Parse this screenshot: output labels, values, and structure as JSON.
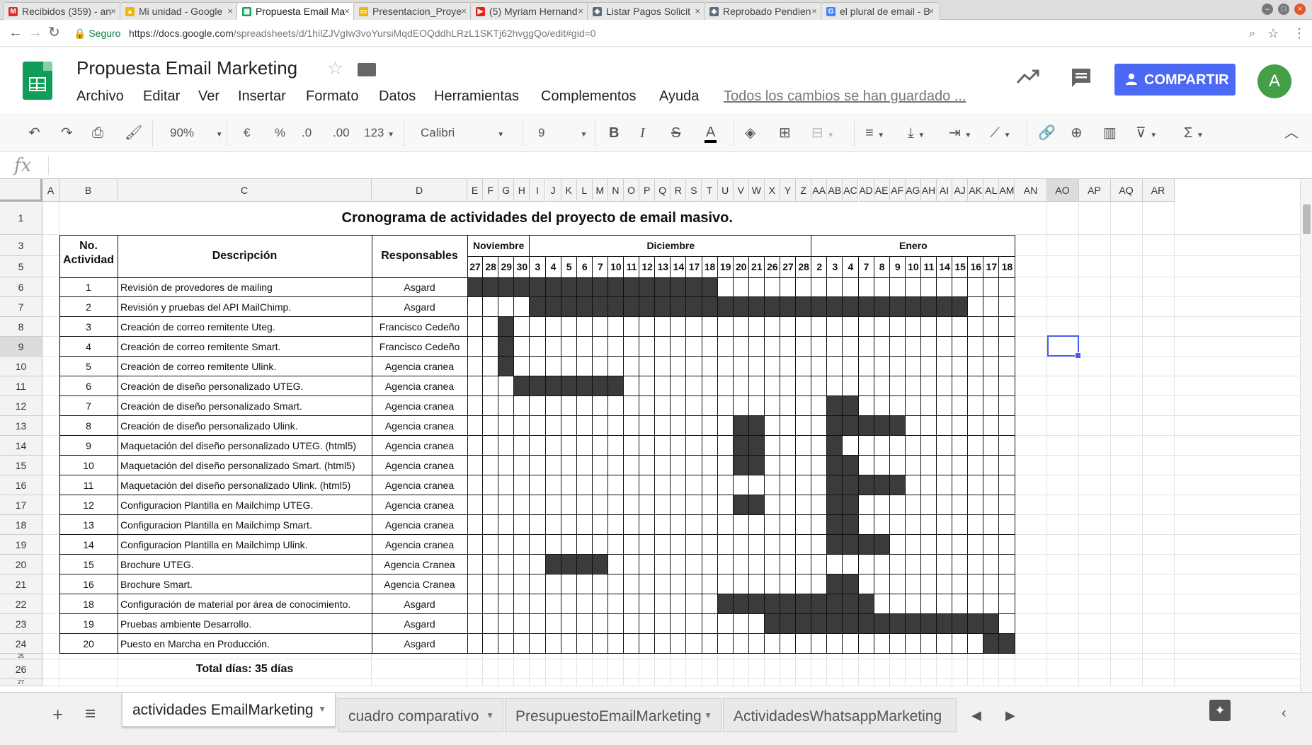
{
  "browser": {
    "tabs": [
      {
        "label": "Recibidos (359) - an",
        "icon": "gmail-icon",
        "color": "#d93025",
        "glyph": "M"
      },
      {
        "label": "Mi unidad - Google",
        "icon": "drive-icon",
        "color": "#f4b400",
        "glyph": "▲"
      },
      {
        "label": "Propuesta Email Ma",
        "icon": "sheets-icon",
        "color": "#0f9d58",
        "glyph": "▦"
      },
      {
        "label": "Presentacion_Proye",
        "icon": "slides-icon",
        "color": "#f4b400",
        "glyph": "▭"
      },
      {
        "label": "(5) Myriam Hernand",
        "icon": "youtube-icon",
        "color": "#e62117",
        "glyph": "▶"
      },
      {
        "label": "Listar Pagos Solicit",
        "icon": "shield-icon",
        "color": "#5f6b7a",
        "glyph": "◈"
      },
      {
        "label": "Reprobado Pendien",
        "icon": "shield-icon",
        "color": "#5f6b7a",
        "glyph": "◈"
      },
      {
        "label": "el plural de email - B",
        "icon": "google-icon",
        "color": "#4285f4",
        "glyph": "G"
      }
    ],
    "active_tab": 2,
    "secure_label": "Seguro",
    "url_host": "https://docs.google.com",
    "url_path": "/spreadsheets/d/1hilZJVgIw3voYursiMqdEOQddhLRzL1SKTj62hvggQo/edit#gid=0"
  },
  "app": {
    "title": "Propuesta Email Marketing",
    "menu": [
      "Archivo",
      "Editar",
      "Ver",
      "Insertar",
      "Formato",
      "Datos",
      "Herramientas",
      "Complementos",
      "Ayuda"
    ],
    "saved_status": "Todos los cambios se han guardado ...",
    "share_label": "COMPARTIR",
    "avatar_letter": "A"
  },
  "toolbar": {
    "zoom": "90%",
    "currency": "€",
    "percent": "%",
    "dec_decrease": ".0",
    "dec_increase": ".00",
    "more_formats": "123",
    "font": "Calibri",
    "font_size": "9",
    "bold": "B",
    "italic": "I",
    "strike": "S",
    "text_color": "A",
    "sum": "Σ"
  },
  "formula_bar": {
    "fx": "fx",
    "value": ""
  },
  "columns": [
    "A",
    "B",
    "C",
    "D",
    "E",
    "F",
    "G",
    "H",
    "I",
    "J",
    "K",
    "L",
    "M",
    "N",
    "O",
    "P",
    "Q",
    "R",
    "S",
    "T",
    "U",
    "V",
    "W",
    "X",
    "Y",
    "Z",
    "AA",
    "AB",
    "AC",
    "AD",
    "AE",
    "AF",
    "AG",
    "AH",
    "AI",
    "AJ",
    "AK",
    "AL",
    "AM",
    "AN",
    "AO",
    "AP",
    "AQ",
    "AR"
  ],
  "selected_column": "AO",
  "rows": [
    "1",
    "3",
    "5",
    "6",
    "7",
    "8",
    "9",
    "10",
    "11",
    "12",
    "13",
    "14",
    "15",
    "16",
    "17",
    "18",
    "19",
    "20",
    "21",
    "22",
    "23",
    "24",
    "25",
    "26",
    "27"
  ],
  "selected_row": "9",
  "sheet": {
    "title": "Cronograma de actividades del proyecto de email masivo.",
    "headers": {
      "number": "No.",
      "activity": "Actividad",
      "description": "Descripción",
      "responsible": "Responsables"
    },
    "months": [
      "Noviembre",
      "Diciembre",
      "Enero"
    ],
    "days": [
      "27",
      "28",
      "29",
      "30",
      "3",
      "4",
      "5",
      "6",
      "7",
      "10",
      "11",
      "12",
      "13",
      "14",
      "17",
      "18",
      "19",
      "20",
      "21",
      "26",
      "27",
      "28",
      "2",
      "3",
      "4",
      "7",
      "8",
      "9",
      "10",
      "11",
      "14",
      "15",
      "16",
      "17",
      "18"
    ],
    "activities": [
      {
        "no": "1",
        "desc": "Revisión de provedores de mailing",
        "resp": "Asgard",
        "bars": [
          [
            0,
            15
          ]
        ]
      },
      {
        "no": "2",
        "desc": "Revisión y pruebas del API MailChimp.",
        "resp": "Asgard",
        "bars": [
          [
            4,
            31
          ]
        ]
      },
      {
        "no": "3",
        "desc": "Creación de correo remitente Uteg.",
        "resp": "Francisco Cedeño",
        "bars": [
          [
            2,
            2
          ]
        ]
      },
      {
        "no": "4",
        "desc": "Creación de correo remitente Smart.",
        "resp": "Francisco Cedeño",
        "bars": [
          [
            2,
            2
          ]
        ]
      },
      {
        "no": "5",
        "desc": "Creación de correo remitente Ulink.",
        "resp": "Agencia cranea",
        "bars": [
          [
            2,
            2
          ]
        ]
      },
      {
        "no": "6",
        "desc": "Creación de diseño personalizado UTEG.",
        "resp": "Agencia cranea",
        "bars": [
          [
            3,
            9
          ]
        ]
      },
      {
        "no": "7",
        "desc": "Creación de diseño personalizado Smart.",
        "resp": "Agencia cranea",
        "bars": [
          [
            23,
            24
          ]
        ]
      },
      {
        "no": "8",
        "desc": "Creación de diseño personalizado Ulink.",
        "resp": "Agencia cranea",
        "bars": [
          [
            17,
            18
          ],
          [
            23,
            27
          ]
        ]
      },
      {
        "no": "9",
        "desc": "Maquetación del diseño personalizado UTEG. (html5)",
        "resp": "Agencia cranea",
        "bars": [
          [
            17,
            18
          ],
          [
            23,
            23
          ]
        ]
      },
      {
        "no": "10",
        "desc": "Maquetación del diseño personalizado Smart. (html5)",
        "resp": "Agencia cranea",
        "bars": [
          [
            17,
            18
          ],
          [
            23,
            24
          ]
        ]
      },
      {
        "no": "11",
        "desc": "Maquetación del diseño personalizado Ulink. (html5)",
        "resp": "Agencia cranea",
        "bars": [
          [
            23,
            27
          ]
        ]
      },
      {
        "no": "12",
        "desc": "Configuracion Plantilla en Mailchimp UTEG.",
        "resp": "Agencia cranea",
        "bars": [
          [
            17,
            18
          ],
          [
            23,
            24
          ]
        ]
      },
      {
        "no": "13",
        "desc": "Configuracion Plantilla en Mailchimp Smart.",
        "resp": "Agencia cranea",
        "bars": [
          [
            23,
            24
          ]
        ]
      },
      {
        "no": "14",
        "desc": "Configuracion Plantilla en Mailchimp Ulink.",
        "resp": "Agencia cranea",
        "bars": [
          [
            23,
            26
          ]
        ]
      },
      {
        "no": "15",
        "desc": "Brochure UTEG.",
        "resp": "Agencia Cranea",
        "bars": [
          [
            5,
            8
          ]
        ]
      },
      {
        "no": "16",
        "desc": "Brochure Smart.",
        "resp": "Agencia Cranea",
        "bars": [
          [
            23,
            24
          ]
        ]
      },
      {
        "no": "18",
        "desc": "Configuración de material por área de conocimiento.",
        "resp": "Asgard",
        "bars": [
          [
            16,
            25
          ]
        ]
      },
      {
        "no": "19",
        "desc": "Pruebas ambiente Desarrollo.",
        "resp": "Asgard",
        "bars": [
          [
            19,
            33
          ]
        ]
      },
      {
        "no": "20",
        "desc": "Puesto en Marcha en Producción.",
        "resp": "Asgard",
        "bars": [
          [
            33,
            34
          ]
        ]
      }
    ],
    "total": "Total días: 35 días"
  },
  "sheet_tabs": [
    "actividades EmailMarketing",
    "cuadro comparativo",
    "PresupuestoEmailMarketing",
    "ActividadesWhatsappMarketing"
  ],
  "active_sheet": 0
}
